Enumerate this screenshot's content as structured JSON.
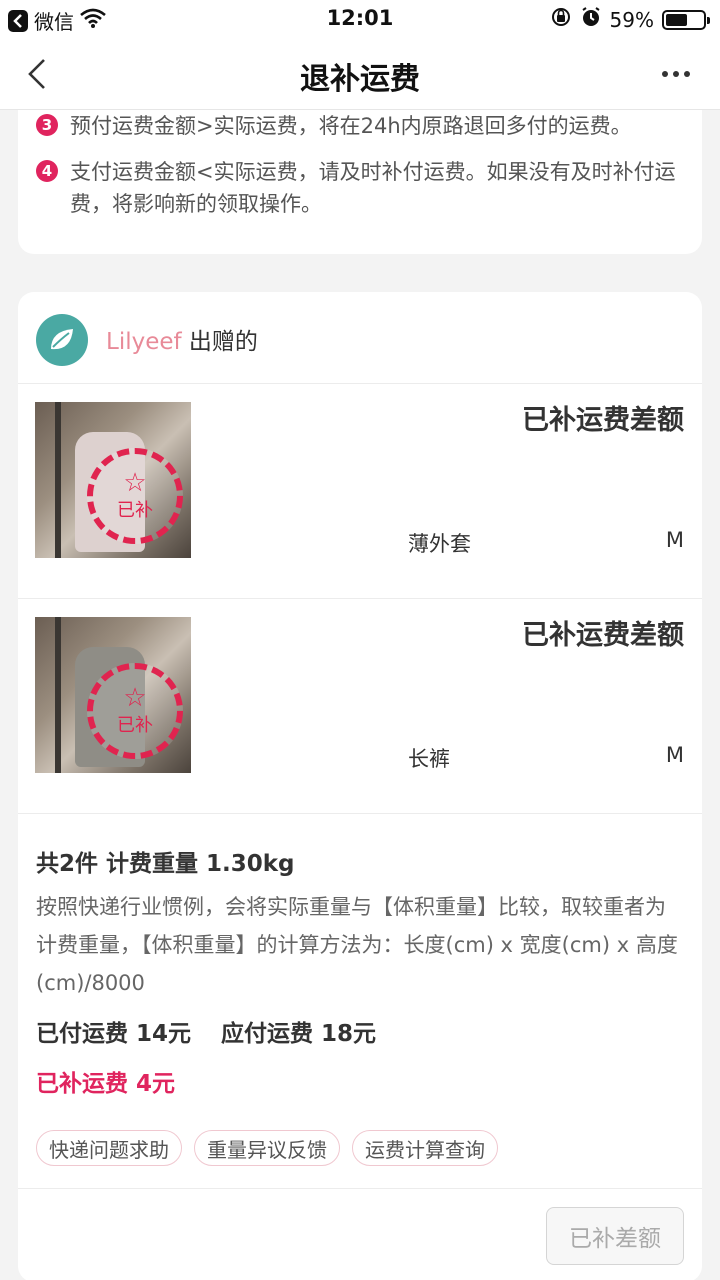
{
  "status_bar": {
    "app_back": "微信",
    "time": "12:01",
    "battery": "59%",
    "battery_level": 0.59
  },
  "nav": {
    "title": "退补运费"
  },
  "notice": {
    "items": [
      {
        "num": "3",
        "text": "预付运费金额>实际运费，将在24h内原路退回多付的运费。"
      },
      {
        "num": "4",
        "text": "支付运费金额<实际运费，请及时补付运费。如果没有及时补付运费，将影响新的领取操作。"
      }
    ]
  },
  "giver": {
    "name": "Lilyeef",
    "suffix": "出赠的"
  },
  "items": [
    {
      "status": "已补运费差额",
      "name": "薄外套",
      "size": "M",
      "stamp": "已补",
      "image_desc": "jacket-photo"
    },
    {
      "status": "已补运费差额",
      "name": "长裤",
      "size": "M",
      "stamp": "已补",
      "image_desc": "pants-photo"
    }
  ],
  "summary": {
    "title": "共2件 计费重量 1.30kg",
    "desc": "按照快递行业惯例，会将实际重量与【体积重量】比较，取较重者为计费重量，【体积重量】的计算方法为：长度(cm) x 宽度(cm) x 高度(cm)/8000",
    "paid": "已付运费 14元",
    "due": "应付运费 18元",
    "extra": "已补运费 4元"
  },
  "chips": [
    "快递问题求助",
    "重量异议反馈",
    "运费计算查询"
  ],
  "footer": {
    "button": "已补差额"
  },
  "colors": {
    "accent": "#e0245e",
    "giver_name": "#e88a98",
    "avatar": "#4aa9a3"
  }
}
